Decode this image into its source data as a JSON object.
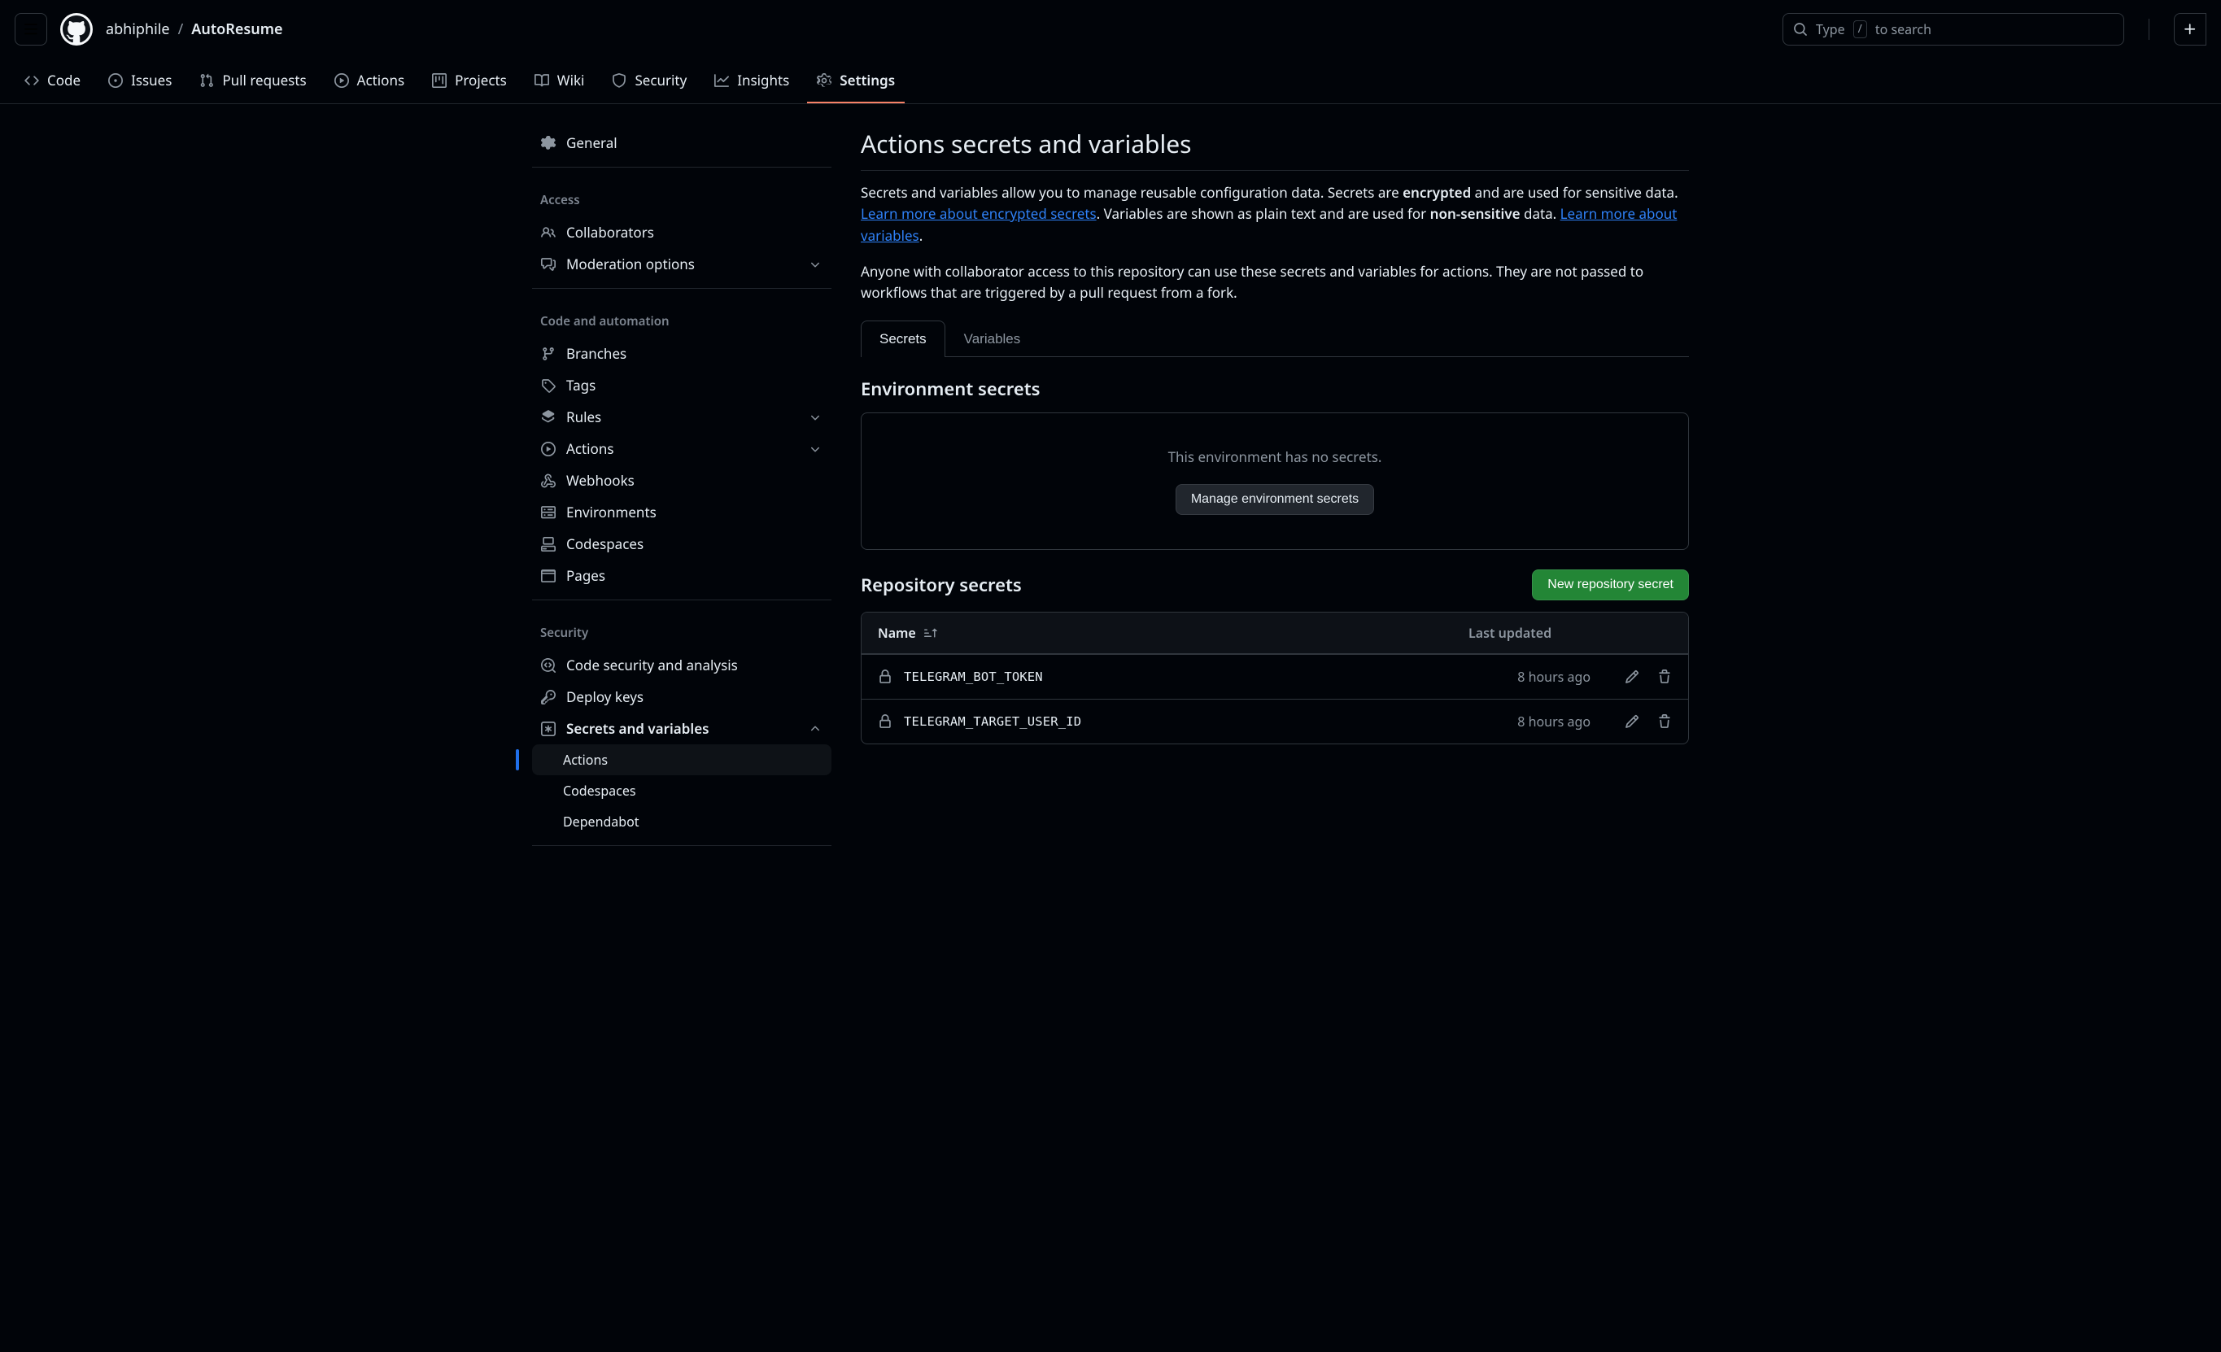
{
  "header": {
    "owner": "abhiphile",
    "repo": "AutoResume",
    "search_placeholder_prefix": "Type",
    "search_slash_key": "/",
    "search_placeholder_suffix": "to search"
  },
  "repo_tabs": [
    {
      "label": "Code"
    },
    {
      "label": "Issues"
    },
    {
      "label": "Pull requests"
    },
    {
      "label": "Actions"
    },
    {
      "label": "Projects"
    },
    {
      "label": "Wiki"
    },
    {
      "label": "Security"
    },
    {
      "label": "Insights"
    },
    {
      "label": "Settings"
    }
  ],
  "sidebar": {
    "general": "General",
    "groups": {
      "access": {
        "heading": "Access",
        "items": [
          {
            "label": "Collaborators"
          },
          {
            "label": "Moderation options",
            "chevron": true
          }
        ]
      },
      "code": {
        "heading": "Code and automation",
        "items": [
          {
            "label": "Branches"
          },
          {
            "label": "Tags"
          },
          {
            "label": "Rules",
            "chevron": true
          },
          {
            "label": "Actions",
            "chevron": true
          },
          {
            "label": "Webhooks"
          },
          {
            "label": "Environments"
          },
          {
            "label": "Codespaces"
          },
          {
            "label": "Pages"
          }
        ]
      },
      "security": {
        "heading": "Security",
        "items": [
          {
            "label": "Code security and analysis"
          },
          {
            "label": "Deploy keys"
          },
          {
            "label": "Secrets and variables",
            "chevron": "up",
            "bold": true
          }
        ],
        "sub": [
          {
            "label": "Actions",
            "active": true
          },
          {
            "label": "Codespaces"
          },
          {
            "label": "Dependabot"
          }
        ]
      }
    }
  },
  "main": {
    "title": "Actions secrets and variables",
    "intro_para1_a": "Secrets and variables allow you to manage reusable configuration data. Secrets are ",
    "intro_para1_b_strong": "encrypted",
    "intro_para1_c": " and are used for sensitive data. ",
    "intro_link1": "Learn more about encrypted secrets",
    "intro_para1_d": ". Variables are shown as plain text and are used for ",
    "intro_para1_e_strong": "non-sensitive",
    "intro_para1_f": " data. ",
    "intro_link2": "Learn more about variables",
    "intro_para1_g": ".",
    "intro_para2": "Anyone with collaborator access to this repository can use these secrets and variables for actions. They are not passed to workflows that are triggered by a pull request from a fork.",
    "subtabs": {
      "secrets": "Secrets",
      "variables": "Variables"
    },
    "env_section": {
      "title": "Environment secrets",
      "empty_msg": "This environment has no secrets.",
      "manage_btn": "Manage environment secrets"
    },
    "repo_section": {
      "title": "Repository secrets",
      "new_btn": "New repository secret",
      "col_name": "Name",
      "col_updated": "Last updated",
      "rows": [
        {
          "name": "TELEGRAM_BOT_TOKEN",
          "updated": "8 hours ago"
        },
        {
          "name": "TELEGRAM_TARGET_USER_ID",
          "updated": "8 hours ago"
        }
      ]
    }
  }
}
